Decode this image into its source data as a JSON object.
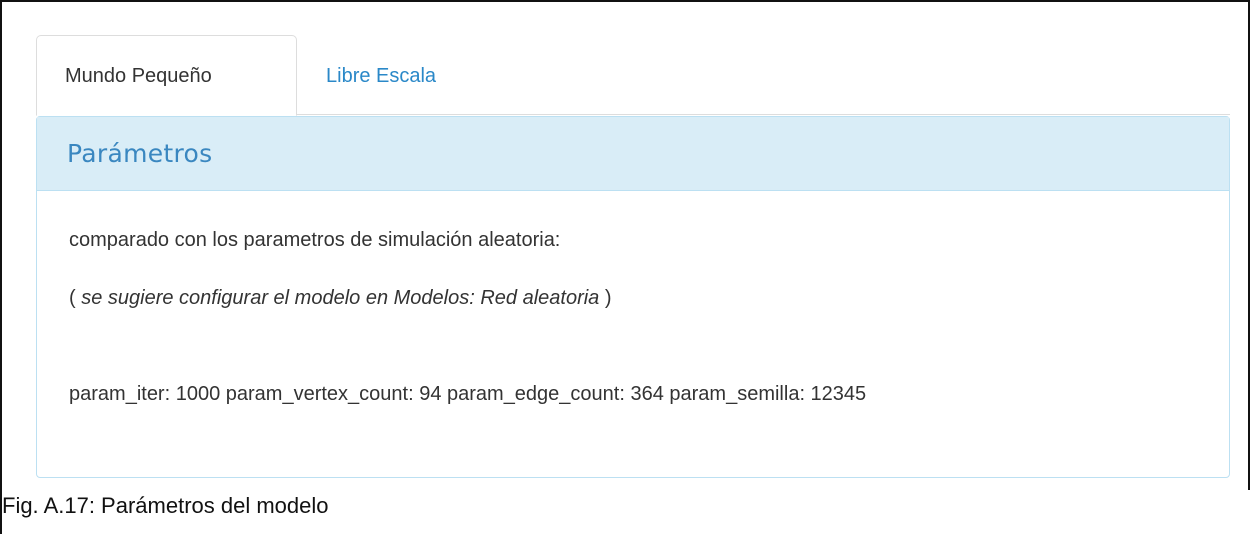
{
  "tabs": [
    {
      "label": "Mundo Pequeño",
      "active": true
    },
    {
      "label": "Libre Escala",
      "active": false
    }
  ],
  "panel": {
    "title": "Parámetros",
    "intro": "comparado con los parametros de simulación aleatoria:",
    "hint_open": "( ",
    "hint_text": "se sugiere configurar el modelo en Modelos: Red aleatoria",
    "hint_close": " )",
    "params_line": "param_iter: 1000 param_vertex_count: 94 param_edge_count: 364 param_semilla: 12345"
  },
  "caption": "Fig. A.17: Parámetros del modelo",
  "colors": {
    "link": "#2a88c8",
    "panel_heading_bg": "#d9edf7",
    "panel_title": "#3a87c0",
    "panel_border": "#bce0f2"
  }
}
